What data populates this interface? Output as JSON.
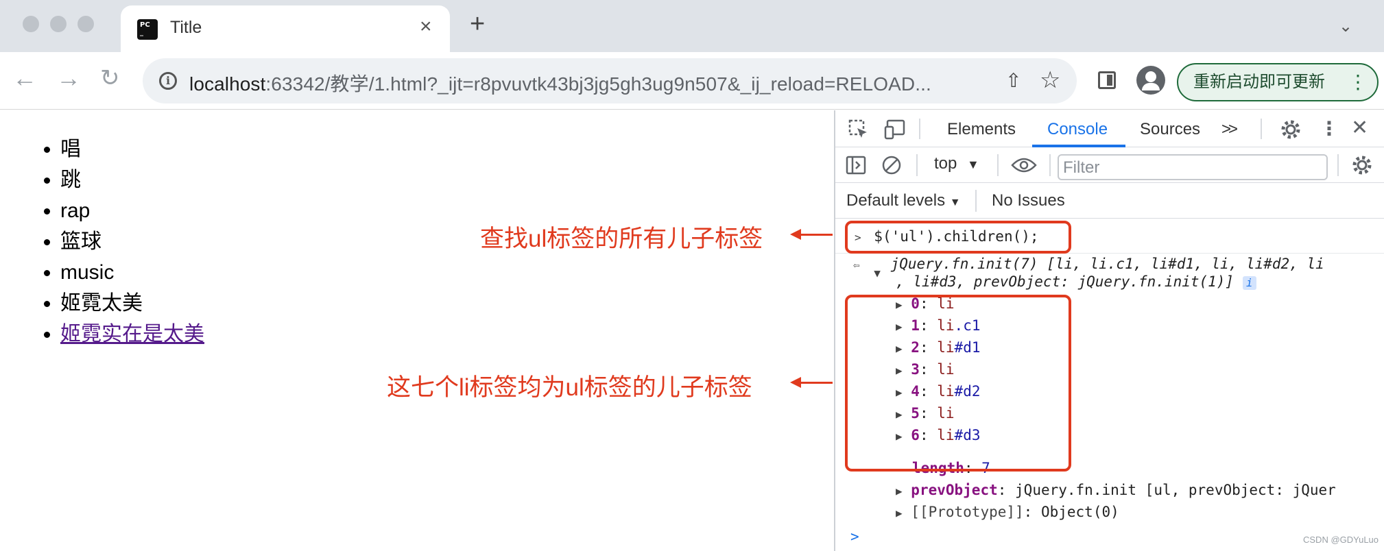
{
  "tab": {
    "title": "Title",
    "close_label": "×",
    "new_tab_label": "+"
  },
  "omnibox": {
    "host": "localhost",
    "rest": ":63342/教学/1.html?_ijt=r8pvuvtk43bj3jg5gh3ug9n507&_ij_reload=RELOAD..."
  },
  "update_button": {
    "label": "重新启动即可更新",
    "more": "⋮"
  },
  "page_list": [
    "唱",
    "跳",
    "rap",
    "篮球",
    "music",
    "姬霓太美"
  ],
  "page_link": "姬霓实在是太美",
  "devtools": {
    "tabs": [
      "Elements",
      "Console",
      "Sources"
    ],
    "more_tabs": ">>",
    "context": "top",
    "filter_placeholder": "Filter",
    "levels": "Default levels",
    "issues": "No Issues"
  },
  "console": {
    "command": "$('ul').children();",
    "result_line1_prefix": "jQuery.fn.init(7) [",
    "result_line1_items": "li, li.c1, li#d1, li, li#d2, li",
    "result_line2": ", li#d3, prevObject: jQuery.fn.init(1)]",
    "info_badge": "i",
    "entries": [
      {
        "key": "0",
        "val": "li",
        "suffix": ""
      },
      {
        "key": "1",
        "val": "li",
        "suffix": ".c1"
      },
      {
        "key": "2",
        "val": "li",
        "suffix": "#d1"
      },
      {
        "key": "3",
        "val": "li",
        "suffix": ""
      },
      {
        "key": "4",
        "val": "li",
        "suffix": "#d2"
      },
      {
        "key": "5",
        "val": "li",
        "suffix": ""
      },
      {
        "key": "6",
        "val": "li",
        "suffix": "#d3"
      }
    ],
    "length_key": "length",
    "length_val": "7",
    "prev_key": "prevObject",
    "prev_val": "jQuery.fn.init [ul, prevObject: jQuer",
    "proto_key": "[[Prototype]]",
    "proto_val": "Object(0)"
  },
  "annotations": {
    "top": "查找ul标签的所有儿子标签",
    "middle": "这七个li标签均为ul标签的儿子标签"
  },
  "watermark": "CSDN @GDYuLuo",
  "colors": {
    "annotation": "#e03a1e",
    "accent": "#1a73e8"
  }
}
